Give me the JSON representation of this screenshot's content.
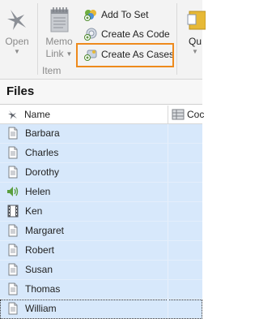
{
  "ribbon": {
    "open_label": "Open",
    "memo_label_line1": "Memo",
    "memo_label_line2": "Link",
    "group_label": "Item",
    "quick_label": "Qu",
    "add_to_set": "Add To Set",
    "create_as_code": "Create As Code",
    "create_as_cases": "Create As Cases",
    "highlight_color": "#ee8a1c"
  },
  "panel": {
    "title": "Files",
    "columns": {
      "name": "Name",
      "codes": "Coc"
    }
  },
  "files": [
    {
      "name": "Barbara",
      "icon": "document-icon"
    },
    {
      "name": "Charles",
      "icon": "document-icon"
    },
    {
      "name": "Dorothy",
      "icon": "document-icon"
    },
    {
      "name": "Helen",
      "icon": "audio-icon"
    },
    {
      "name": "Ken",
      "icon": "video-icon"
    },
    {
      "name": "Margaret",
      "icon": "document-icon"
    },
    {
      "name": "Robert",
      "icon": "document-icon"
    },
    {
      "name": "Susan",
      "icon": "document-icon"
    },
    {
      "name": "Thomas",
      "icon": "document-icon"
    },
    {
      "name": "William",
      "icon": "document-icon"
    }
  ],
  "selection_color": "#d7e8fb"
}
